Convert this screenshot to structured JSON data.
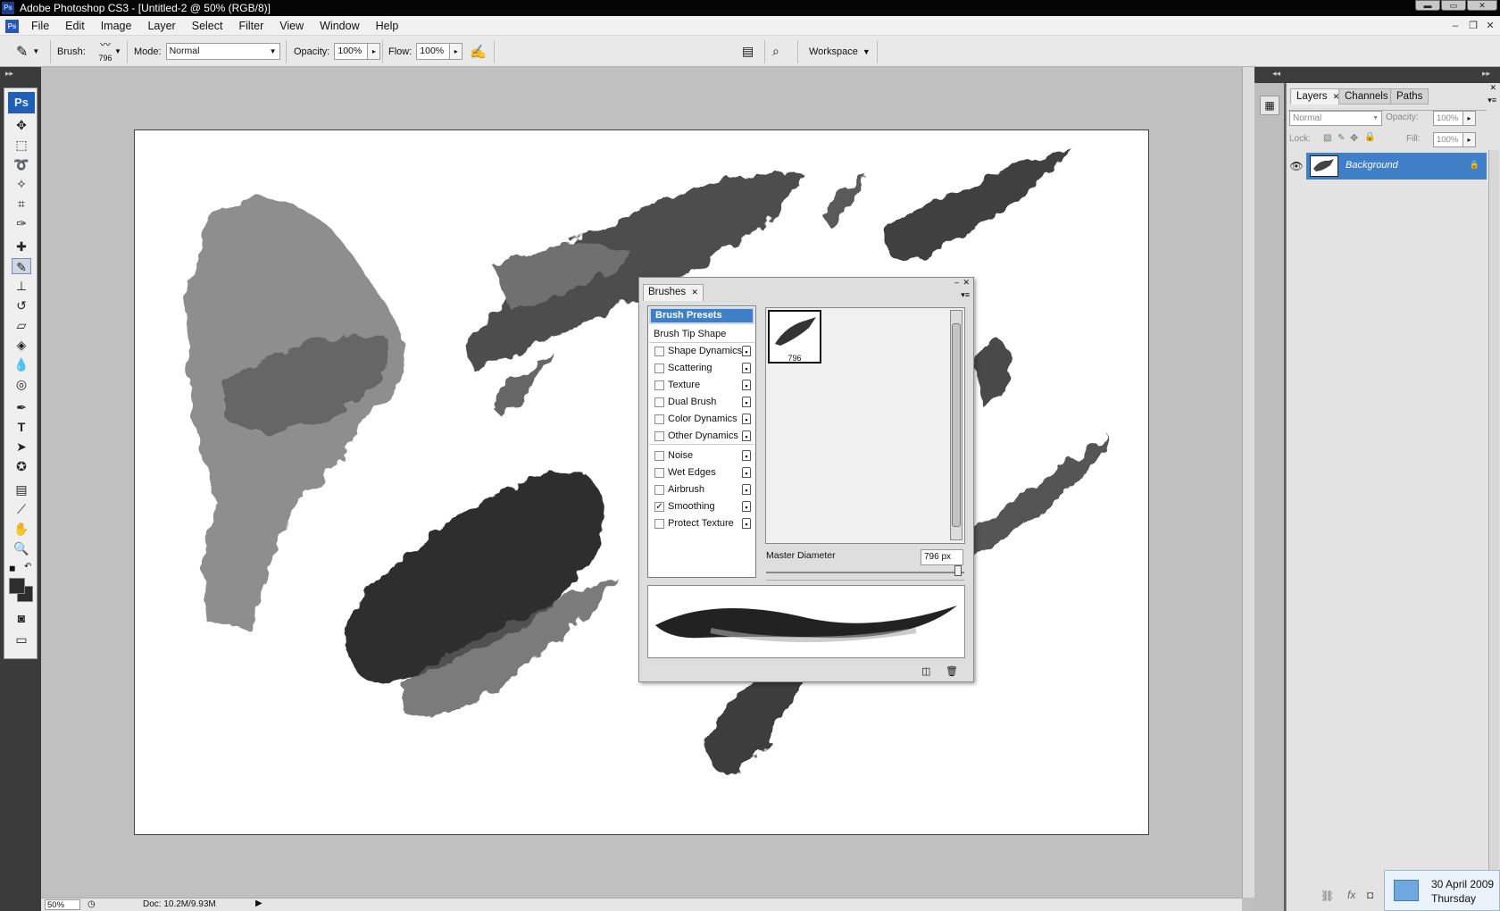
{
  "titlebar": {
    "app_badge": "Ps",
    "title": "Adobe Photoshop CS3 - [Untitled-2 @ 50% (RGB/8)]"
  },
  "menubar": {
    "items": [
      "File",
      "Edit",
      "Image",
      "Layer",
      "Select",
      "Filter",
      "View",
      "Window",
      "Help"
    ]
  },
  "options": {
    "brush_label": "Brush:",
    "brush_size": "796",
    "mode_label": "Mode:",
    "mode_value": "Normal",
    "opacity_label": "Opacity:",
    "opacity_value": "100%",
    "flow_label": "Flow:",
    "flow_value": "100%",
    "workspace_label": "Workspace"
  },
  "toolbox": {
    "badge": "Ps",
    "tools": [
      "move-tool-icon",
      "marquee-tool-icon",
      "lasso-tool-icon",
      "magic-wand-tool-icon",
      "crop-tool-icon",
      "slice-tool-icon",
      "healing-brush-tool-icon",
      "brush-tool-icon",
      "clone-stamp-tool-icon",
      "history-brush-tool-icon",
      "eraser-tool-icon",
      "paint-bucket-tool-icon",
      "blur-tool-icon",
      "dodge-tool-icon",
      "pen-tool-icon",
      "type-tool-icon",
      "path-selection-tool-icon",
      "custom-shape-tool-icon",
      "notes-tool-icon",
      "eyedropper-tool-icon",
      "hand-tool-icon",
      "zoom-tool-icon"
    ]
  },
  "brushes_panel": {
    "tab": "Brushes",
    "items": [
      {
        "label": "Brush Presets",
        "checkbox": false,
        "lock": false,
        "selected": true
      },
      {
        "label": "Brush Tip Shape",
        "checkbox": false,
        "lock": false,
        "selected": false
      },
      {
        "label": "Shape Dynamics",
        "checkbox": true,
        "checked": false,
        "lock": true
      },
      {
        "label": "Scattering",
        "checkbox": true,
        "checked": false,
        "lock": true
      },
      {
        "label": "Texture",
        "checkbox": true,
        "checked": false,
        "lock": true
      },
      {
        "label": "Dual Brush",
        "checkbox": true,
        "checked": false,
        "lock": true
      },
      {
        "label": "Color Dynamics",
        "checkbox": true,
        "checked": false,
        "lock": true
      },
      {
        "label": "Other Dynamics",
        "checkbox": true,
        "checked": false,
        "lock": true
      },
      {
        "label": "Noise",
        "checkbox": true,
        "checked": false,
        "lock": true
      },
      {
        "label": "Wet Edges",
        "checkbox": true,
        "checked": false,
        "lock": true
      },
      {
        "label": "Airbrush",
        "checkbox": true,
        "checked": false,
        "lock": true
      },
      {
        "label": "Smoothing",
        "checkbox": true,
        "checked": true,
        "lock": true
      },
      {
        "label": "Protect Texture",
        "checkbox": true,
        "checked": false,
        "lock": true
      }
    ],
    "preset_size": "796",
    "master_diameter_label": "Master Diameter",
    "master_diameter_value": "796 px",
    "slider_fraction": 0.97
  },
  "layers_panel": {
    "tabs": [
      "Layers",
      "Channels",
      "Paths"
    ],
    "blend_mode": "Normal",
    "opacity_label": "Opacity:",
    "opacity_value": "100%",
    "lock_label": "Lock:",
    "fill_label": "Fill:",
    "fill_value": "100%",
    "layer_name": "Background"
  },
  "status": {
    "zoom": "50%",
    "doc_info": "Doc: 10.2M/9.93M"
  },
  "clock": {
    "date": "30 April 2009",
    "day": "Thursday"
  },
  "colors": {
    "accent_blue": "#3e7fc7",
    "title_bg": "#050505",
    "ps_badge": "#1f5fb9"
  }
}
